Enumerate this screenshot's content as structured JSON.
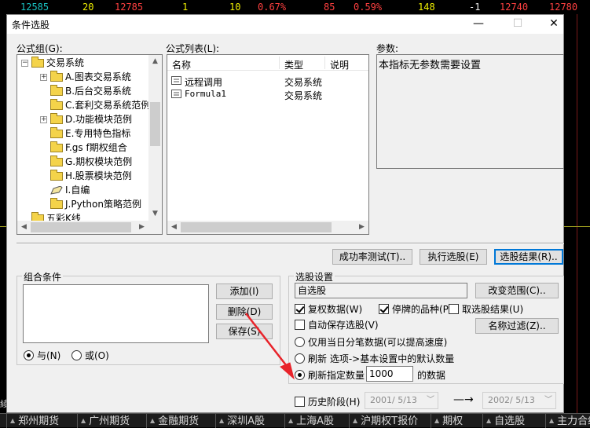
{
  "ticker": {
    "items": [
      {
        "text": "12585",
        "color": "#19c3c3"
      },
      {
        "text": "20",
        "color": "#f0f000"
      },
      {
        "text": "12785",
        "color": "#ff4040"
      },
      {
        "text": "1",
        "color": "#f0f000"
      },
      {
        "text": "10",
        "color": "#f0f000"
      },
      {
        "text": "0.67%",
        "color": "#ff4040"
      },
      {
        "text": "85",
        "color": "#ff4040"
      },
      {
        "text": "0.59%",
        "color": "#ff4040"
      },
      {
        "text": "148",
        "color": "#f0f000"
      },
      {
        "text": "-1",
        "color": "#f0f0f0"
      },
      {
        "text": "12740",
        "color": "#ff4040"
      },
      {
        "text": "12780",
        "color": "#ff4040"
      }
    ]
  },
  "background": {
    "left_text": "綾"
  },
  "dialog": {
    "title": "条件选股",
    "minimize": "—",
    "maximize": "☐",
    "close": "✕",
    "formula_group_label": "公式组(G):",
    "tree": [
      {
        "label": "交易系统",
        "level": 0,
        "expander": "⊟"
      },
      {
        "label": "A.图表交易系统",
        "level": 1,
        "expander": "+"
      },
      {
        "label": "B.后台交易系统",
        "level": 1
      },
      {
        "label": "C.套利交易系统范例",
        "level": 1
      },
      {
        "label": "D.功能模块范例",
        "level": 1,
        "expander": "+"
      },
      {
        "label": "E.专用特色指标",
        "level": 1
      },
      {
        "label": "F.gs f期权组合",
        "level": 1
      },
      {
        "label": "G.期权模块范例",
        "level": 1
      },
      {
        "label": "H.股票模块范例",
        "level": 1
      },
      {
        "label": "I.自编",
        "level": 1,
        "icon": "pencil"
      },
      {
        "label": "J.Python策略范例",
        "level": 1
      },
      {
        "label": "五彩K线",
        "level": 0
      }
    ],
    "formula_list_label": "公式列表(L):",
    "formula_columns": [
      "名称",
      "类型",
      "说明"
    ],
    "formula_rows": [
      {
        "name": "远程调用",
        "type": "交易系统"
      },
      {
        "name": "Formula1",
        "type": "交易系统"
      }
    ],
    "params_label": "参数:",
    "params_text": "本指标无参数需要设置",
    "btn_success_rate": "成功率测试(T)..",
    "btn_execute": "执行选股(E)",
    "btn_result": "选股结果(R)..",
    "combo_label": "组合条件",
    "btn_add": "添加(I)",
    "btn_delete": "删除(D)",
    "btn_save": "保存(S)",
    "radio_and": "与(N)",
    "radio_or": "或(O)",
    "settings_label": "选股设置",
    "settings_target": "自选股",
    "btn_change_range": "改变范围(C)..",
    "cb_restore": "复权数据(W)",
    "cb_suspended": "停牌的品种(P)",
    "cb_take_result": "取选股结果(U)",
    "cb_autosave": "自动保存选股(V)",
    "btn_name_filter": "名称过滤(Z)..",
    "opt_today_only": "仅用当日分笔数据(可以提高速度)",
    "opt_refresh_default": "刷新 选项->基本设置中的默认数量",
    "opt_refresh_count": "刷新指定数量",
    "refresh_count_value": "1000",
    "refresh_count_suffix": "的数据",
    "cb_history": "历史阶段(H)",
    "date_from": "2001/ 5/13",
    "date_to": "2002/ 5/13",
    "date_arrow": "—→",
    "colors": {
      "accent": "#0078d7",
      "annotation_arrow": "#e8232a"
    }
  },
  "tabs": [
    {
      "label": "郑州期货"
    },
    {
      "label": "广州期货"
    },
    {
      "label": "金融期货"
    },
    {
      "label": "深圳A股"
    },
    {
      "label": "上海A股"
    },
    {
      "label": "沪期权T报价"
    },
    {
      "label": "期权"
    },
    {
      "label": "自选股"
    },
    {
      "label": "主力合约"
    }
  ]
}
